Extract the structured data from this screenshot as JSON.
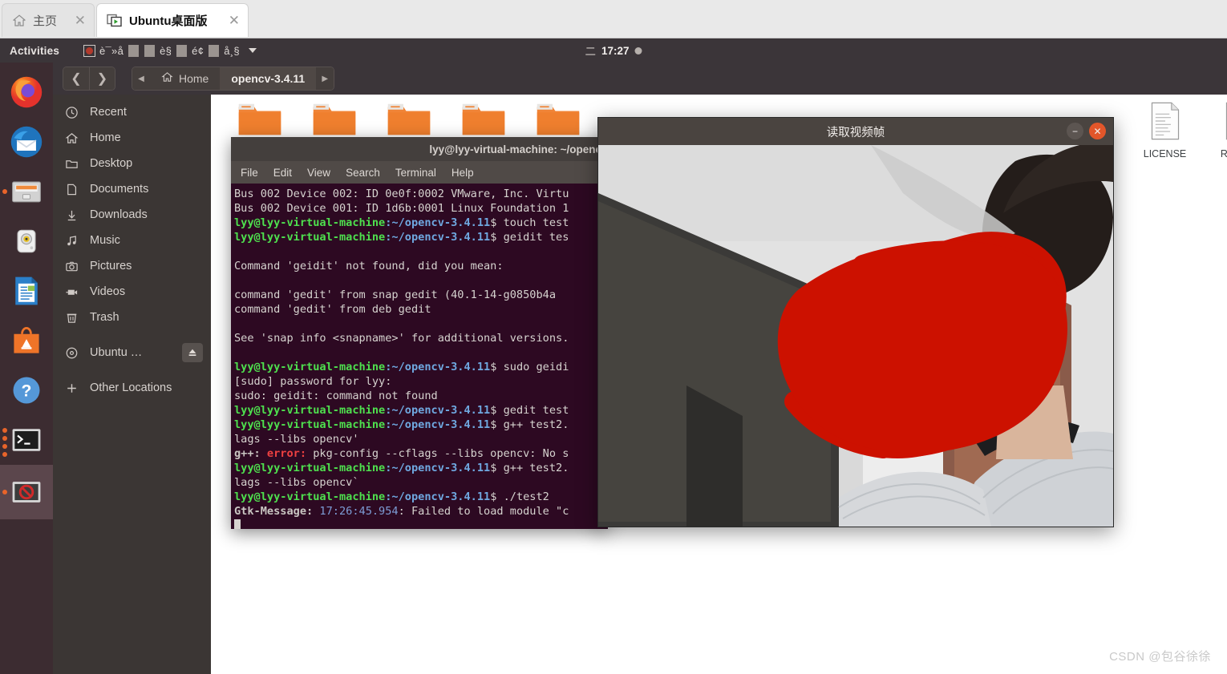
{
  "browser": {
    "tabs": [
      {
        "title": "主页",
        "icon": "home-icon",
        "active": false,
        "close": "✕"
      },
      {
        "title": "Ubuntu桌面版",
        "icon": "screen-play-icon",
        "active": true,
        "close": "✕"
      }
    ]
  },
  "top_panel": {
    "activities": "Activities",
    "ime_mojibake": "è¯»å",
    "ime_mojibake2": "è§",
    "ime_mojibake3": "é¢",
    "ime_mojibake4": "å¸§",
    "clock_weekday": "二",
    "clock_time": "17:27"
  },
  "dock": {
    "items": [
      {
        "name": "firefox",
        "label": "Firefox",
        "running": false
      },
      {
        "name": "thunderbird",
        "label": "Thunderbird Mail",
        "running": false
      },
      {
        "name": "files",
        "label": "Files",
        "running": true,
        "dots": 1
      },
      {
        "name": "rhythmbox",
        "label": "Rhythmbox",
        "running": false
      },
      {
        "name": "libreoffice-writer",
        "label": "LibreOffice Writer",
        "running": false
      },
      {
        "name": "ubuntu-software",
        "label": "Ubuntu Software",
        "running": false
      },
      {
        "name": "help",
        "label": "Help",
        "running": false
      },
      {
        "name": "terminal",
        "label": "Terminal",
        "running": true,
        "dots": 4
      },
      {
        "name": "blocked-app",
        "label": "Application",
        "running": true,
        "dots": 1,
        "focused": true
      }
    ]
  },
  "file_manager": {
    "nav": {
      "back": "❮",
      "forward": "❯",
      "crumb_prev": "◀",
      "crumb_next": "▶"
    },
    "breadcrumbs": [
      {
        "label": "Home",
        "icon": "home-icon",
        "current": false
      },
      {
        "label": "opencv-3.4.11",
        "icon": "",
        "current": true
      }
    ],
    "sidebar": [
      {
        "label": "Recent",
        "icon": "clock-icon"
      },
      {
        "label": "Home",
        "icon": "home-icon"
      },
      {
        "label": "Desktop",
        "icon": "folder-icon"
      },
      {
        "label": "Documents",
        "icon": "document-icon"
      },
      {
        "label": "Downloads",
        "icon": "download-icon"
      },
      {
        "label": "Music",
        "icon": "music-note-icon"
      },
      {
        "label": "Pictures",
        "icon": "camera-icon"
      },
      {
        "label": "Videos",
        "icon": "video-camera-icon"
      },
      {
        "label": "Trash",
        "icon": "trash-icon"
      }
    ],
    "sidebar_devices": [
      {
        "label": "Ubuntu …",
        "icon": "disc-icon",
        "eject": "⏏"
      }
    ],
    "sidebar_other": {
      "label": "Other Locations",
      "icon": "plus-icon"
    },
    "files_row1": [
      {
        "name": "",
        "icon": "folder-icon"
      },
      {
        "name": "",
        "icon": "folder-icon"
      },
      {
        "name": "",
        "icon": "folder-icon"
      },
      {
        "name": "",
        "icon": "folder-icon"
      },
      {
        "name": "",
        "icon": "folder-icon"
      }
    ],
    "files_right": [
      {
        "name": "LICENSE",
        "icon": "text-file-icon"
      },
      {
        "name": "READ…\nmc",
        "icon": "text-file-icon"
      }
    ]
  },
  "terminal": {
    "title": "lyy@lyy-virtual-machine: ~/openc",
    "menu": [
      "File",
      "Edit",
      "View",
      "Search",
      "Terminal",
      "Help"
    ],
    "prompt_user": "lyy@lyy-virtual-machine",
    "prompt_path": ":~/opencv-3.4.11",
    "prompt_sym": "$",
    "lines": [
      {
        "type": "plain",
        "text": "Bus 002 Device 002: ID 0e0f:0002 VMware, Inc. Virtu"
      },
      {
        "type": "plain",
        "text": "Bus 002 Device 001: ID 1d6b:0001 Linux Foundation 1"
      },
      {
        "type": "prompt",
        "cmd": " touch test"
      },
      {
        "type": "prompt",
        "cmd": " geidit tes"
      },
      {
        "type": "plain",
        "text": ""
      },
      {
        "type": "plain",
        "text": "Command 'geidit' not found, did you mean:"
      },
      {
        "type": "plain",
        "text": ""
      },
      {
        "type": "plain",
        "text": "  command 'gedit' from snap gedit (40.1-14-g0850b4a"
      },
      {
        "type": "plain",
        "text": "  command 'gedit' from deb gedit"
      },
      {
        "type": "plain",
        "text": ""
      },
      {
        "type": "plain",
        "text": "See 'snap info <snapname>' for additional versions."
      },
      {
        "type": "plain",
        "text": ""
      },
      {
        "type": "prompt",
        "cmd": " sudo geidi"
      },
      {
        "type": "plain",
        "text": "[sudo] password for lyy:"
      },
      {
        "type": "plain",
        "text": "sudo: geidit: command not found"
      },
      {
        "type": "prompt",
        "cmd": " gedit test"
      },
      {
        "type": "prompt",
        "cmd": " g++ test2."
      },
      {
        "type": "plain",
        "text": "lags --libs opencv'"
      },
      {
        "type": "error",
        "prefix": "g++:",
        "kw": "error:",
        "text": " pkg-config --cflags --libs opencv: No s"
      },
      {
        "type": "prompt",
        "cmd": " g++ test2."
      },
      {
        "type": "plain",
        "text": "lags --libs opencv`"
      },
      {
        "type": "prompt",
        "cmd": " ./test2"
      },
      {
        "type": "gtk",
        "label": "Gtk-Message:",
        "time": " 17:26:45.954",
        "text": ": Failed to load module \"c"
      },
      {
        "type": "cursor"
      }
    ]
  },
  "video_window": {
    "title": "读取视频帧",
    "minimize": "−",
    "close": "✕"
  },
  "watermark": "CSDN @包谷徐徐",
  "colors": {
    "panel_bg": "#3b3539",
    "terminal_bg": "#2d0922",
    "dock_bg": "#3c2c31",
    "accent_orange": "#e8642a",
    "prompt_green": "#4ee04e",
    "prompt_blue": "#6fa8e0",
    "error_red": "#ef4141",
    "scribble_red": "#cc1100"
  }
}
